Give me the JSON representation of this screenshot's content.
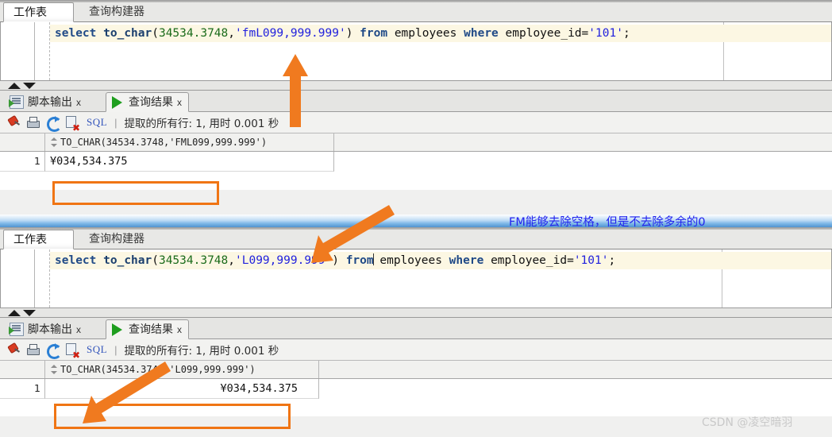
{
  "worksheet_tabs": [
    {
      "label": "工作表",
      "active": true
    },
    {
      "label": "查询构建器",
      "active": false
    }
  ],
  "panels": [
    {
      "sql": {
        "keyword1": "select",
        "function": "to_char",
        "open_paren": "(",
        "number": "34534.3748",
        "comma": ",",
        "format_string": "'fmL099,999.999'",
        "close_paren": ")",
        "keyword2": "from",
        "table": "employees",
        "keyword3": "where",
        "column": "employee_id=",
        "value": "'101'",
        "terminator": ";",
        "full_text": "select to_char(34534.3748,'fmL099,999.999') from employees where employee_id='101';"
      },
      "result_tabs": [
        {
          "label": "脚本输出",
          "icon": "script-output-icon",
          "active": false,
          "close": "x"
        },
        {
          "label": "查询结果",
          "icon": "play-icon",
          "active": true,
          "close": "x"
        }
      ],
      "toolbar": {
        "icons": [
          "pin-icon",
          "print-icon",
          "refresh-icon",
          "clear-icon"
        ],
        "sql_label": "SQL",
        "separator": "|",
        "status": "提取的所有行: 1, 用时 0.001 秒"
      },
      "grid": {
        "column_header": "TO_CHAR(34534.3748,'FML099,999.999')",
        "row_number": "1",
        "cell_value": "¥034,534.375",
        "cell_align": "left"
      }
    },
    {
      "sql": {
        "keyword1": "select",
        "function": "to_char",
        "open_paren": "(",
        "number": "34534.3748",
        "comma": ",",
        "format_string": "'L099,999.999'",
        "close_paren": ")",
        "keyword2": "from",
        "table": "employees",
        "keyword3": "where",
        "column": "employee_id=",
        "value": "'101'",
        "terminator": ";",
        "full_text": "select to_char(34534.3748,'L099,999.999') from employees where employee_id='101';"
      },
      "result_tabs": [
        {
          "label": "脚本输出",
          "icon": "script-output-icon",
          "active": false,
          "close": "x"
        },
        {
          "label": "查询结果",
          "icon": "play-icon",
          "active": true,
          "close": "x"
        }
      ],
      "toolbar": {
        "icons": [
          "pin-icon",
          "print-icon",
          "refresh-icon",
          "clear-icon"
        ],
        "sql_label": "SQL",
        "separator": "|",
        "status": "提取的所有行: 1, 用时 0.001 秒"
      },
      "grid": {
        "column_header": "TO_CHAR(34534.3748,'L099,999.999')",
        "row_number": "1",
        "cell_value": "¥034,534.375",
        "cell_align": "right"
      }
    }
  ],
  "annotation": {
    "text": "FM能够去除空格，但是不去除多余的0",
    "color": "#2222ee"
  },
  "watermark": {
    "text": "CSDN @凌空暗羽"
  },
  "accent": {
    "highlight_color": "#f07514",
    "arrow_color": "#f07a1f"
  }
}
